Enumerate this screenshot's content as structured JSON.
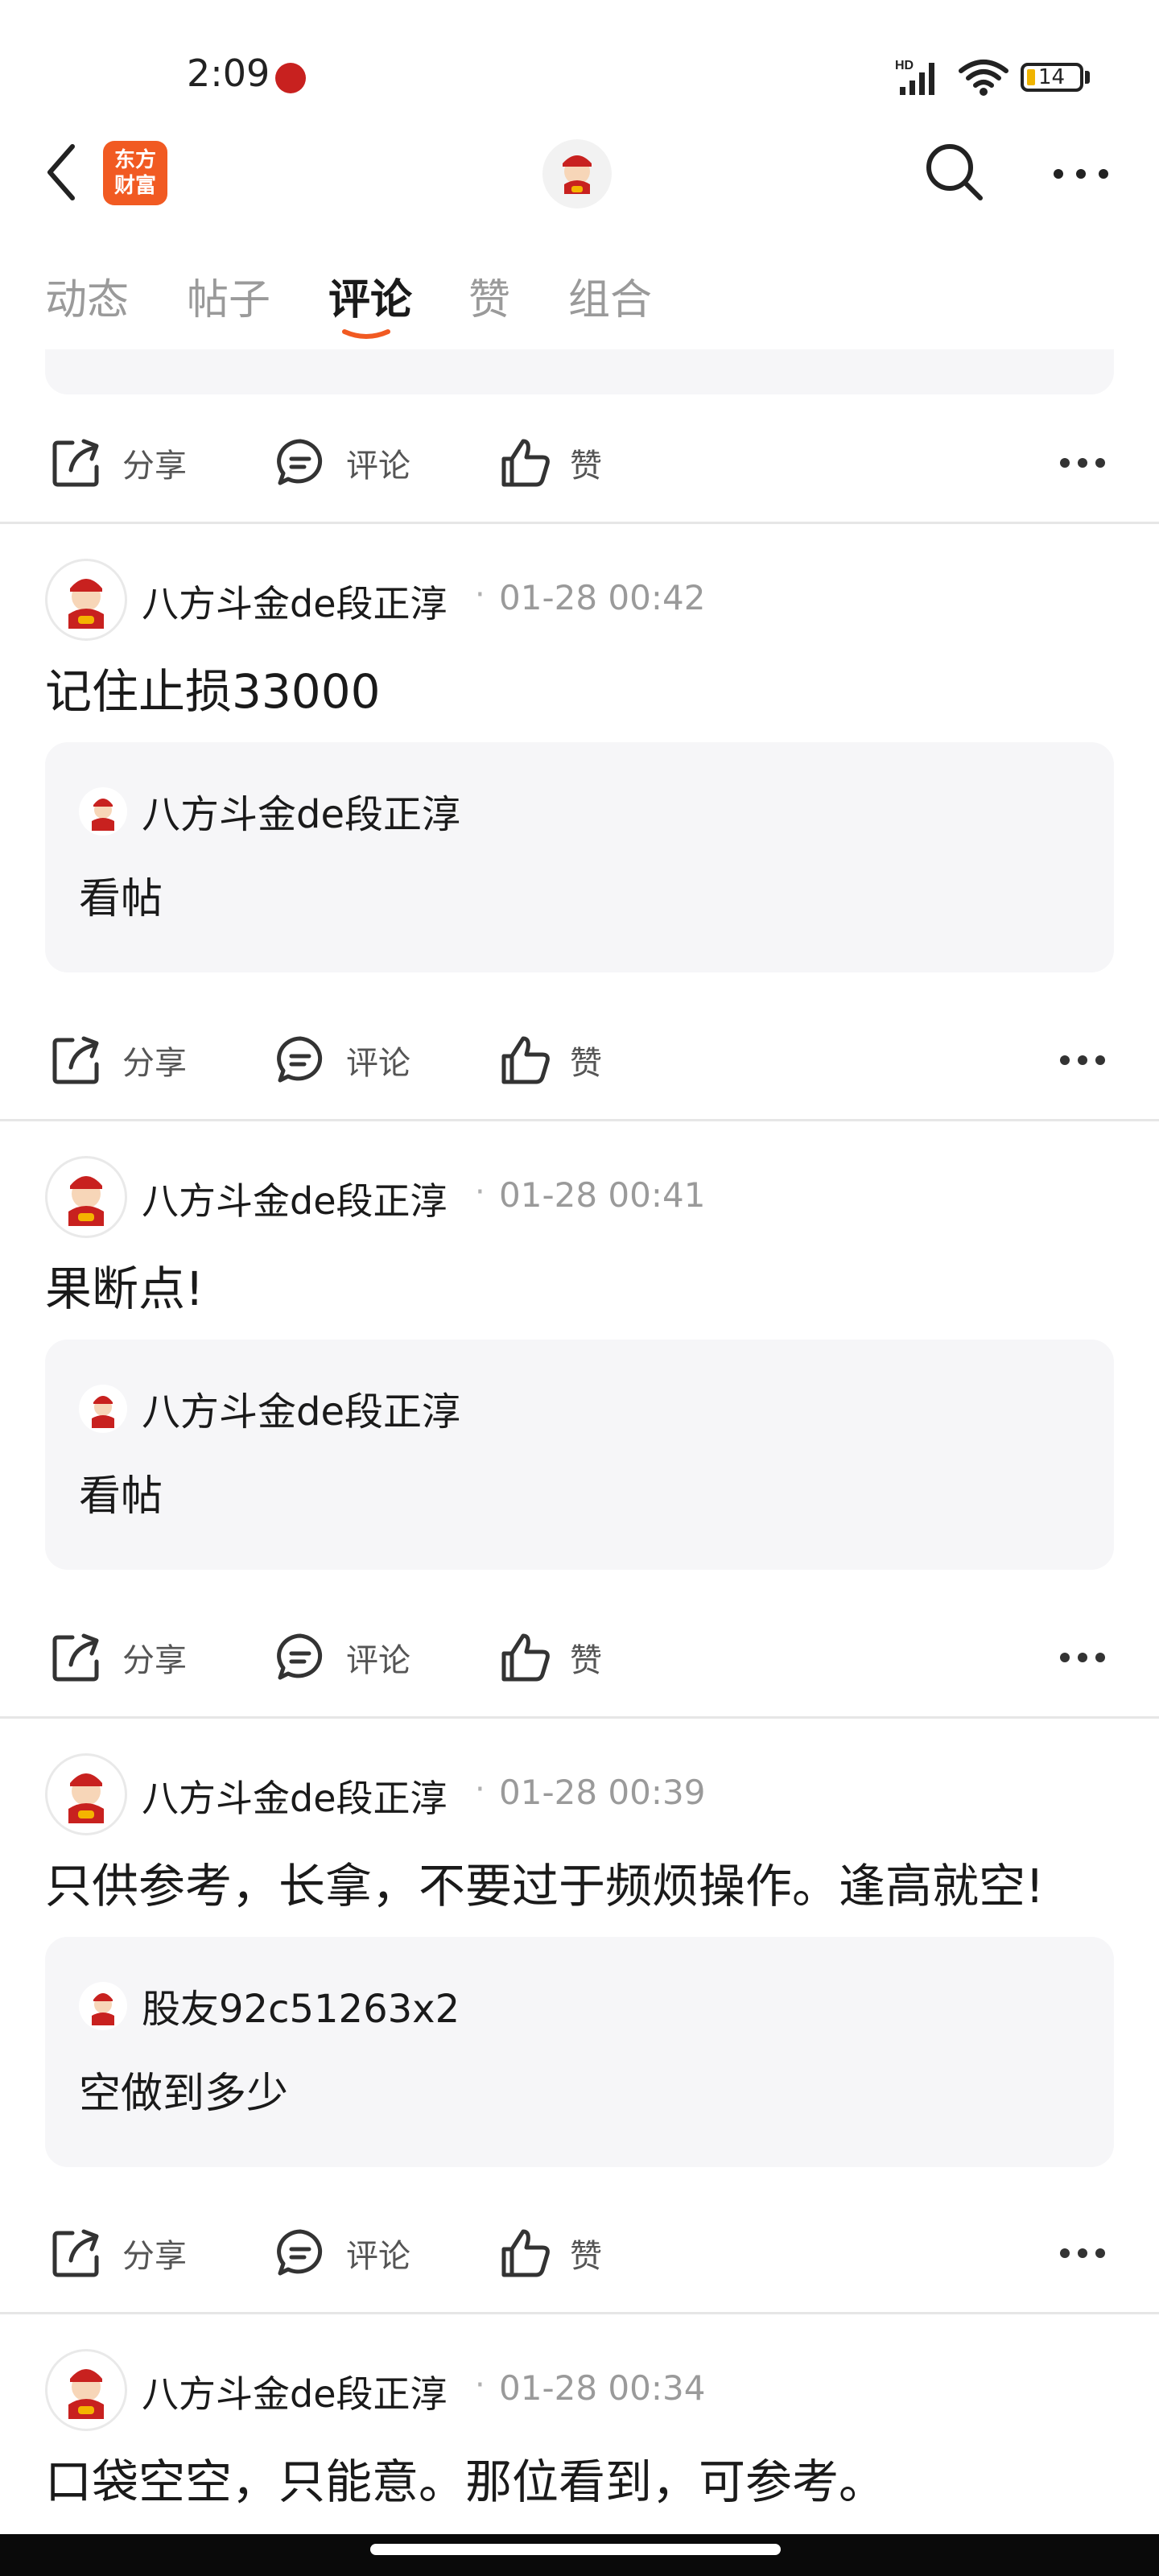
{
  "status_bar": {
    "time": "2:09",
    "network_label": "HD",
    "battery": "14"
  },
  "header": {
    "app_logo_line1": "东方",
    "app_logo_line2": "财富"
  },
  "tabs": [
    {
      "label": "动态"
    },
    {
      "label": "帖子"
    },
    {
      "label": "评论",
      "active": true
    },
    {
      "label": "赞"
    },
    {
      "label": "组合"
    }
  ],
  "actions": {
    "share": "分享",
    "comment": "评论",
    "like": "赞"
  },
  "posts": [
    {
      "author": "八方斗金de段正淳",
      "separator": "·",
      "time": "01-28 00:42",
      "text": "记住止损33000",
      "quote": {
        "author": "八方斗金de段正淳",
        "text": "看帖"
      }
    },
    {
      "author": "八方斗金de段正淳",
      "separator": "·",
      "time": "01-28 00:41",
      "text": "果断点!",
      "quote": {
        "author": "八方斗金de段正淳",
        "text": "看帖"
      }
    },
    {
      "author": "八方斗金de段正淳",
      "separator": "·",
      "time": "01-28 00:39",
      "text": "只供参考，长拿，不要过于频烦操作。逢高就空!",
      "quote": {
        "author": "股友92c51263x2",
        "text": "空做到多少"
      }
    },
    {
      "author": "八方斗金de段正淳",
      "separator": "·",
      "time": "01-28 00:34",
      "text": "口袋空空，只能意。那位看到，可参考。"
    }
  ],
  "colors": {
    "accent": "#f15a22",
    "tab_active": "#1a1a1a",
    "tab_inactive": "#9a9a9a",
    "quote_bg": "#f6f6f8"
  }
}
